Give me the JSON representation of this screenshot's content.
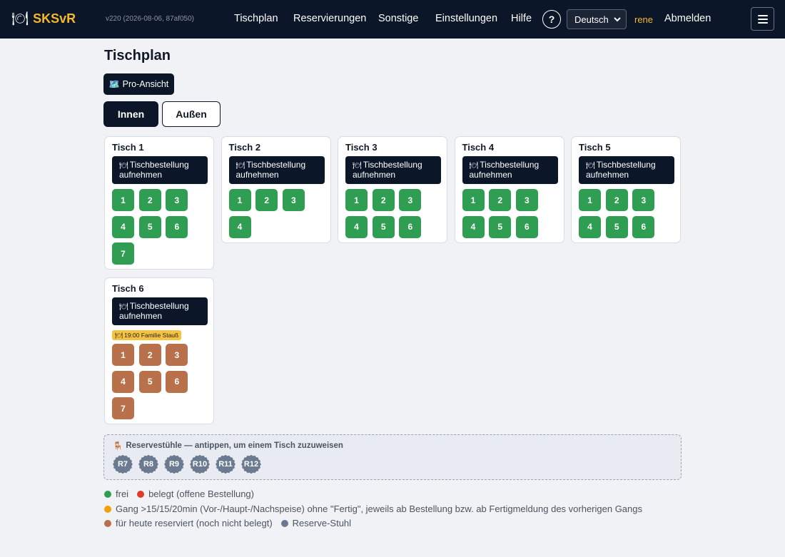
{
  "header": {
    "brand": "SKSvR",
    "logo_icon": "🍽",
    "version": "v220 (2026-08-06, 87af050)",
    "nav": [
      "Tischplan",
      "Reservierungen",
      "Sonstige",
      "Einstellungen",
      "Hilfe"
    ],
    "help_label": "?",
    "language": "Deutsch",
    "user": "rene",
    "logout": "Abmelden"
  },
  "page": {
    "title": "Tischplan",
    "pro_view": "Pro-Ansicht",
    "pro_view_icon": "🗺️",
    "tabs": [
      "Innen",
      "Außen"
    ],
    "active_tab": "Innen"
  },
  "order_label_line1": "Tischbestellung",
  "order_label_line2": "aufnehmen",
  "order_icon": "🍽",
  "tables": [
    {
      "name": "Tisch 1",
      "seats": [
        "1",
        "2",
        "3",
        "4",
        "5",
        "6",
        "7"
      ],
      "status": "free"
    },
    {
      "name": "Tisch 2",
      "seats": [
        "1",
        "2",
        "3",
        "4"
      ],
      "status": "free"
    },
    {
      "name": "Tisch 3",
      "seats": [
        "1",
        "2",
        "3",
        "4",
        "5",
        "6"
      ],
      "status": "free"
    },
    {
      "name": "Tisch 4",
      "seats": [
        "1",
        "2",
        "3",
        "4",
        "5",
        "6"
      ],
      "status": "free"
    },
    {
      "name": "Tisch 5",
      "seats": [
        "1",
        "2",
        "3",
        "4",
        "5",
        "6"
      ],
      "status": "free"
    },
    {
      "name": "Tisch 6",
      "seats": [
        "1",
        "2",
        "3",
        "4",
        "5",
        "6",
        "7"
      ],
      "status": "reserved",
      "reservation": "🍽 19:00 Familie Stauß"
    }
  ],
  "reserve": {
    "icon": "🪑",
    "label": "Reservestühle — antippen, um einem Tisch zuzuweisen",
    "chairs": [
      "R7",
      "R8",
      "R9",
      "R10",
      "R11",
      "R12"
    ]
  },
  "legend": {
    "free": "frei",
    "occupied": "belegt (offene Bestellung)",
    "course": "Gang >15/15/20min (Vor-/Haupt-/Nachspeise) ohne \"Fertig\", jeweils ab Bestellung bzw. ab Fertigmeldung des vorherigen Gangs",
    "reserved": "für heute reserviert (noch nicht belegt)",
    "reserve_chair": "Reserve-Stuhl"
  },
  "colors": {
    "navy": "#0b1628",
    "brand": "#f5b82e",
    "free": "#2f9e52",
    "occupied": "#e03a2f",
    "course": "#f59e0b",
    "reserved": "#b8714a",
    "reserve_chair": "#6b7a90"
  }
}
